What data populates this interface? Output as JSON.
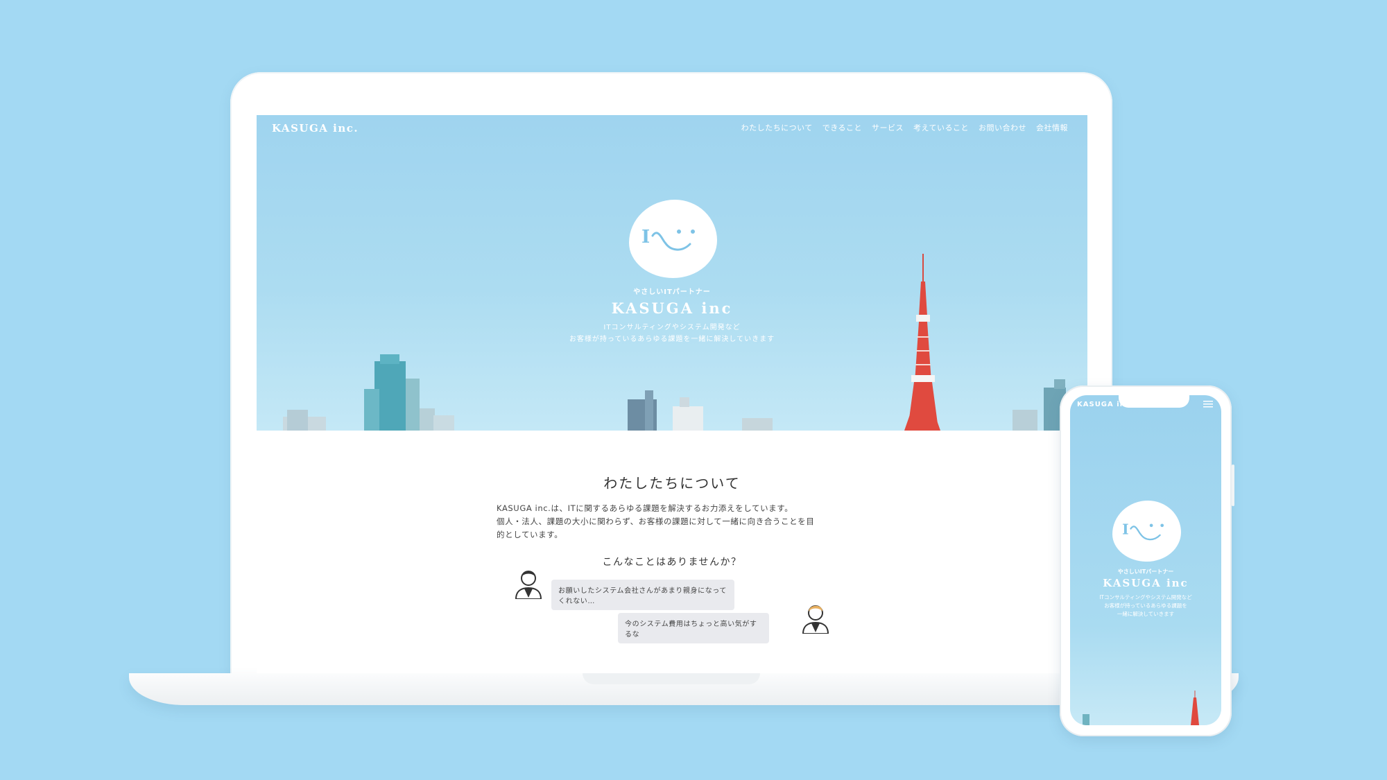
{
  "site": {
    "logo": "KASUGA inc.",
    "nav": [
      "わたしたちについて",
      "できること",
      "サービス",
      "考えていること",
      "お問い合わせ",
      "会社情報"
    ]
  },
  "hero": {
    "tagline": "やさしいITパートナー",
    "company": "KASUGA inc",
    "description_line1": "ITコンサルティングやシステム開発など",
    "description_line2": "お客様が持っているあらゆる課題を一緒に解決していきます"
  },
  "about": {
    "title": "わたしたちについて",
    "body_line1": "KASUGA inc.は、ITに関するあらゆる課題を解決するお力添えをしています。",
    "body_line2": "個人・法人、課題の大小に関わらず、お客様の課題に対して一緒に向き合うことを目",
    "body_line3": "的としています。",
    "question": "こんなことはありませんか？",
    "bubble1": "お願いしたシステム会社さんがあまり親身になってくれない…",
    "bubble2": "今のシステム費用はちょっと高い気がするな"
  },
  "phone": {
    "logo": "KASUGA inc.",
    "tagline": "やさしいITパートナー",
    "company": "KASUGA inc",
    "description_line1": "ITコンサルティングやシステム開発など",
    "description_line2": "お客様が持っているあらゆる課題を",
    "description_line3": "一緒に解決していきます"
  },
  "colors": {
    "background": "#a3d9f3",
    "sky": "#a6d8f0",
    "logo_accent": "#7ec3e6",
    "tower_red": "#e0493e"
  },
  "icons": [
    "smile-logo-icon",
    "hamburger-menu-icon",
    "businessman-icon"
  ]
}
